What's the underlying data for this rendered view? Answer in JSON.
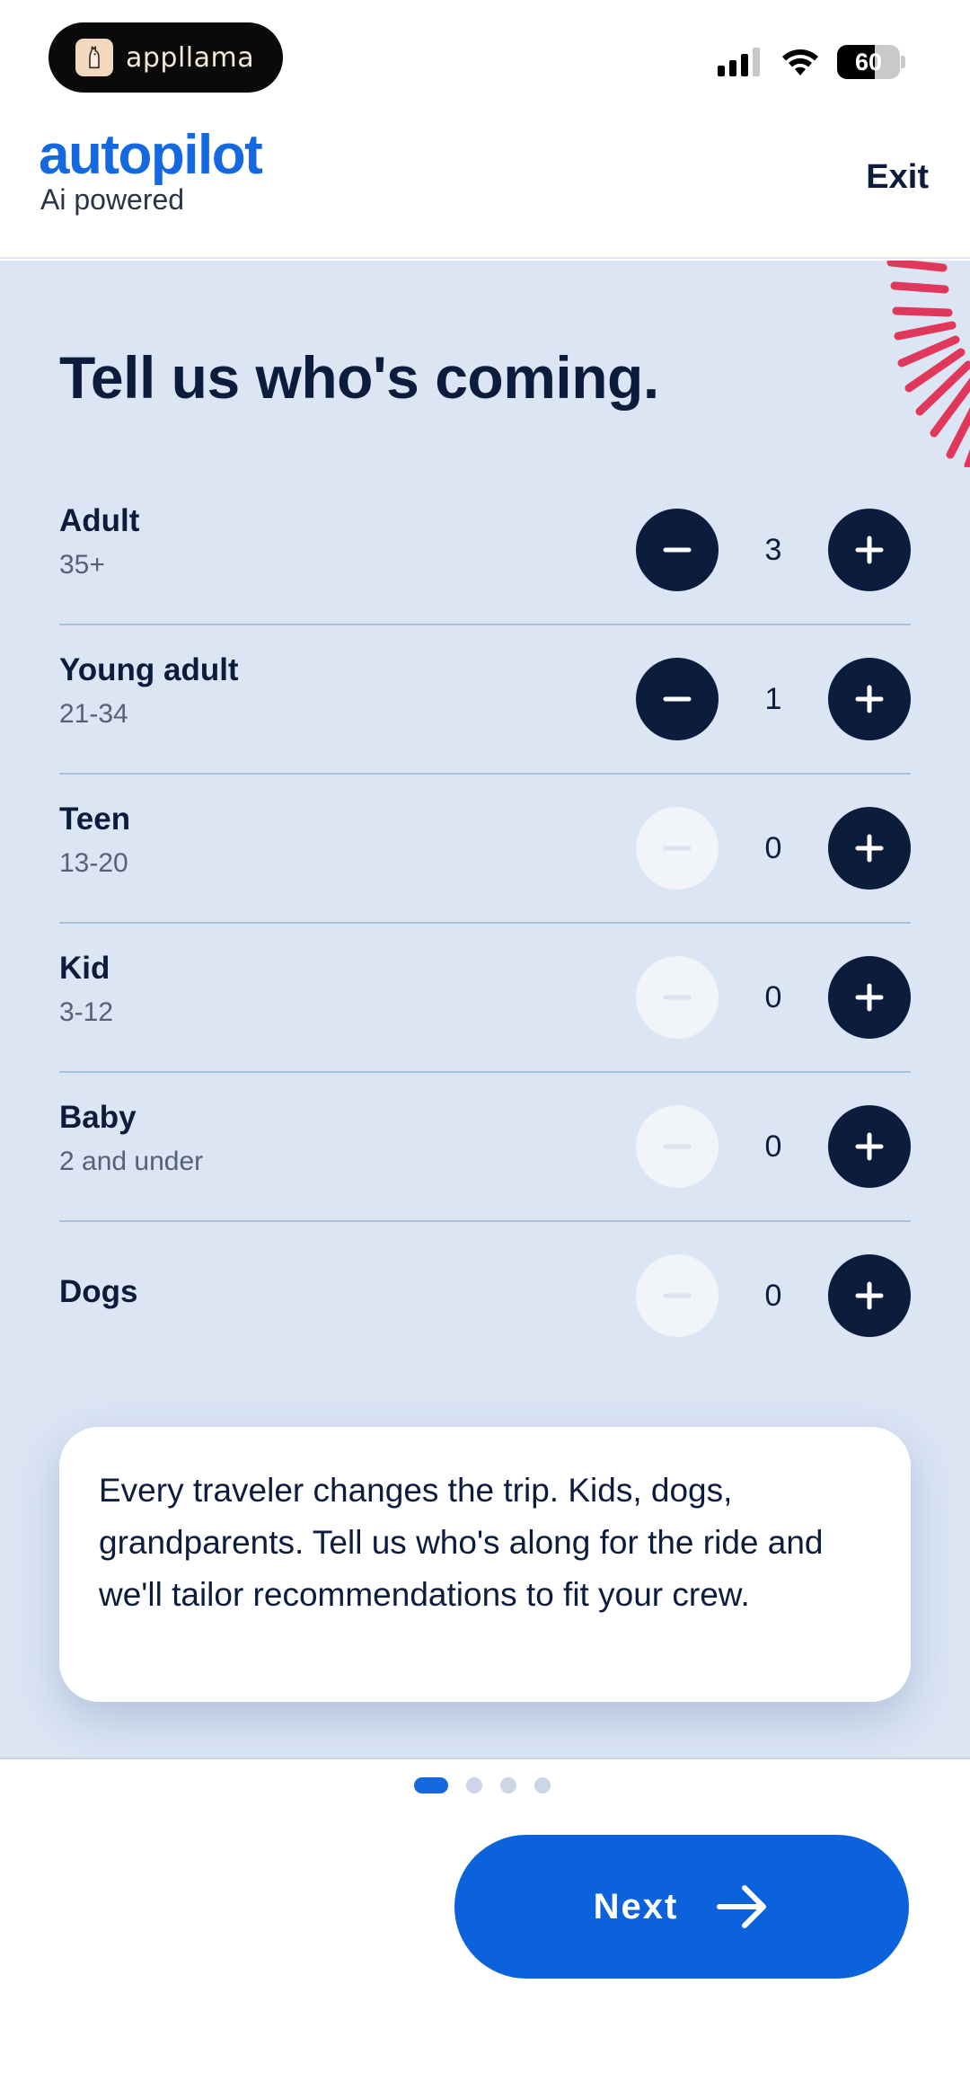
{
  "status_bar": {
    "app_name": "appllama",
    "battery": "60",
    "battery_level_percent": 60
  },
  "header": {
    "brand": "autopilot",
    "tagline": "Ai powered",
    "exit_label": "Exit"
  },
  "main": {
    "title": "Tell us who's coming.",
    "rows": [
      {
        "label": "Adult",
        "sub": "35+",
        "count": "3",
        "minus_enabled": true
      },
      {
        "label": "Young adult",
        "sub": "21-34",
        "count": "1",
        "minus_enabled": true
      },
      {
        "label": "Teen",
        "sub": "13-20",
        "count": "0",
        "minus_enabled": false
      },
      {
        "label": "Kid",
        "sub": "3-12",
        "count": "0",
        "minus_enabled": false
      },
      {
        "label": "Baby",
        "sub": "2 and under",
        "count": "0",
        "minus_enabled": false
      },
      {
        "label": "Dogs",
        "sub": "",
        "count": "0",
        "minus_enabled": false
      }
    ],
    "info": "Every traveler changes the trip. Kids, dogs, grandparents. Tell us who's along for the ride and we'll tailor recommendations to fit your crew."
  },
  "footer": {
    "pager": {
      "total": 4,
      "current": 1
    },
    "next_label": "Next"
  },
  "icons": {
    "app": "llama-icon",
    "signal": "signal-icon",
    "wifi": "wifi-icon",
    "battery": "battery-icon",
    "minus": "minus-icon",
    "plus": "plus-icon",
    "next": "arrow-right-icon"
  },
  "colors": {
    "brand_blue": "#1569e0",
    "navy": "#0b1c3d",
    "background": "#dbe5f4",
    "burst_red": "#e0375a"
  }
}
